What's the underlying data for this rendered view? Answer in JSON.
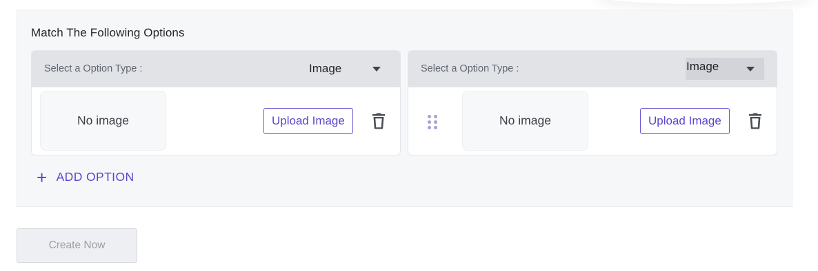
{
  "section": {
    "title": "Match The Following Options"
  },
  "options": [
    {
      "type_label": "Select a Option Type :",
      "type_value": "Image",
      "image_placeholder": "No image",
      "upload_label": "Upload Image"
    },
    {
      "type_label": "Select a Option Type :",
      "type_value": "Image",
      "image_placeholder": "No image",
      "upload_label": "Upload Image"
    }
  ],
  "add_option_label": "ADD OPTION",
  "create_label": "Create Now",
  "colors": {
    "accent": "#5a45cf",
    "panel_bg": "#f6f7f9",
    "card_header_bg": "#e1e3e7",
    "disabled_text": "#9aa0a8"
  },
  "icons": {
    "delete": "trash-icon",
    "drag": "drag-handle-icon",
    "add": "plus-icon",
    "dropdown": "caret-down-icon"
  }
}
